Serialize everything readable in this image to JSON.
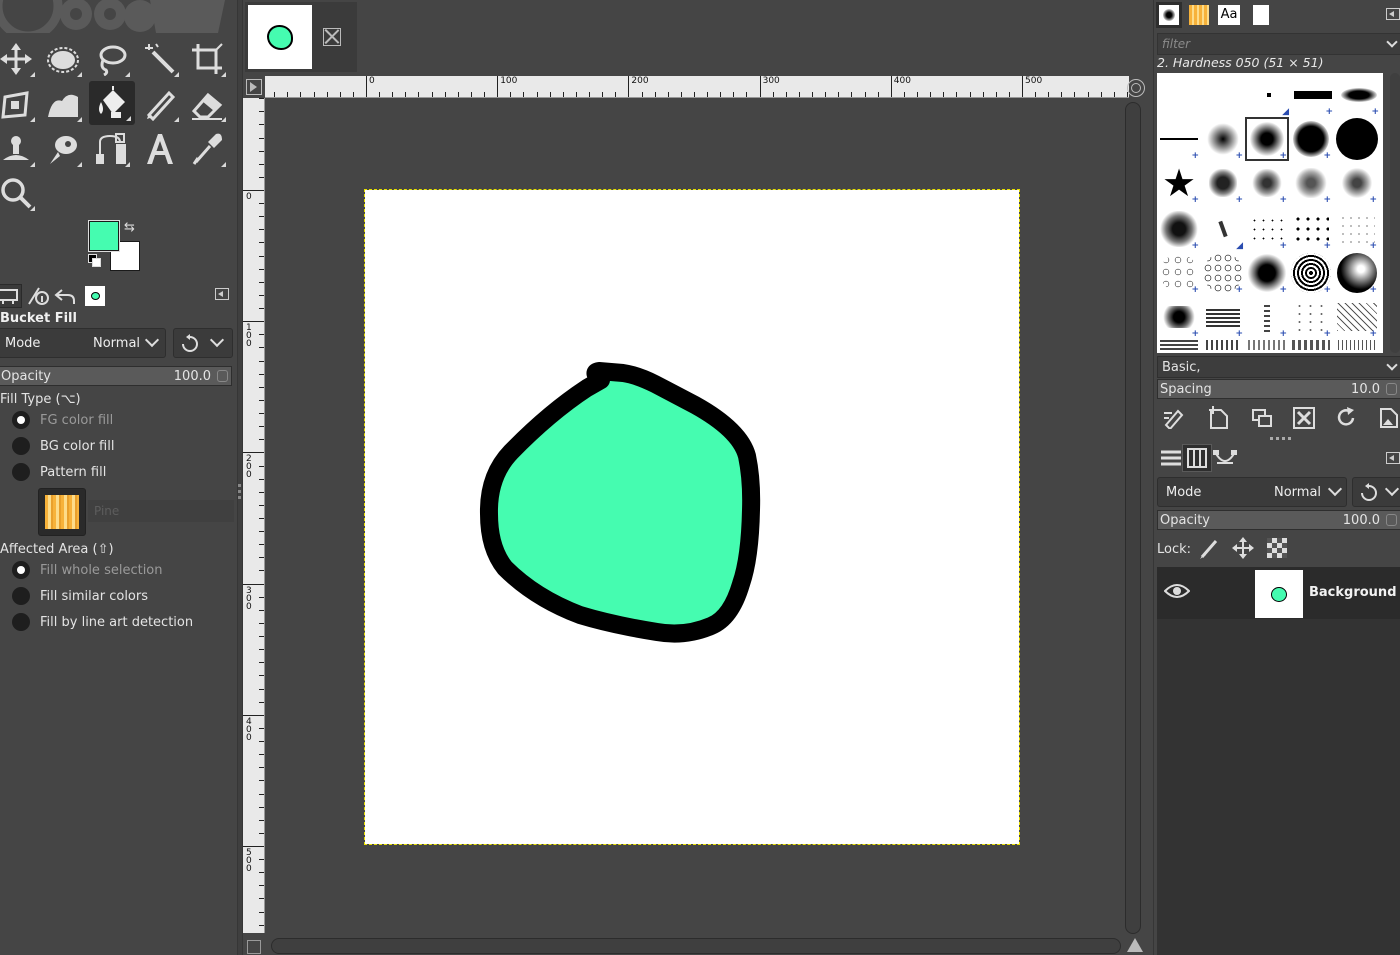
{
  "colors": {
    "accent_fg": "#45fcb0",
    "bg_color": "#ffffff",
    "ui_bg": "#454545",
    "selection_outline": "#e8e000"
  },
  "tool_options": {
    "title": "Bucket Fill",
    "mode_label": "Mode",
    "mode_value": "Normal",
    "opacity_label": "Opacity",
    "opacity_value": "100.0",
    "fill_type_label": "Fill Type  (⌥)",
    "fill_type_options": [
      "FG color fill",
      "BG color fill",
      "Pattern fill"
    ],
    "pattern_name": "Pine",
    "affected_area_label": "Affected Area  (⇧)",
    "affected_area_options": [
      "Fill whole selection",
      "Fill similar colors",
      "Fill by line art detection"
    ]
  },
  "rulers": {
    "h_labels": [
      "0",
      "100",
      "200",
      "300",
      "400",
      "500"
    ],
    "v_labels": [
      "0",
      "1\n0\n0",
      "2\n0\n0",
      "3\n0\n0",
      "4\n0\n0",
      "5\n0\n0"
    ]
  },
  "brushes": {
    "tab_font_label": "Aa",
    "filter_placeholder": "filter",
    "selected_brush": "2. Hardness 050 (51 × 51)",
    "tag_value": "Basic,",
    "spacing_label": "Spacing",
    "spacing_value": "10.0"
  },
  "layers": {
    "mode_label": "Mode",
    "mode_value": "Normal",
    "opacity_label": "Opacity",
    "opacity_value": "100.0",
    "lock_label": "Lock:",
    "items": [
      {
        "name": "Background"
      }
    ]
  }
}
